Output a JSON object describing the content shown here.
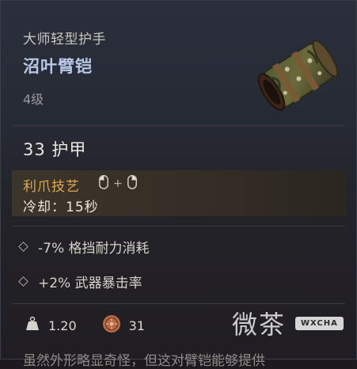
{
  "item": {
    "type": "大师轻型护手",
    "name": "沼叶臂铠",
    "level": "4级",
    "armor": "33 护甲"
  },
  "skill": {
    "name": "利爪技艺",
    "combo_plus": "+",
    "cooldown": "冷却：15秒",
    "icons": [
      "mouse-left-icon",
      "mouse-right-icon"
    ]
  },
  "stats": [
    {
      "text": "-7% 格挡耐力消耗"
    },
    {
      "text": "+2% 武器暴击率"
    }
  ],
  "footer": {
    "weight": "1.20",
    "price": "31",
    "weight_icon": "weight-icon",
    "price_icon": "coin-icon"
  },
  "description": "虽然外形略显奇怪，但这对臂铠能够提供",
  "watermark": {
    "text": "微茶",
    "badge": "WXCHA"
  },
  "colors": {
    "name": "#b8c7e6",
    "skill": "#e2a84e",
    "background": "#232228"
  }
}
